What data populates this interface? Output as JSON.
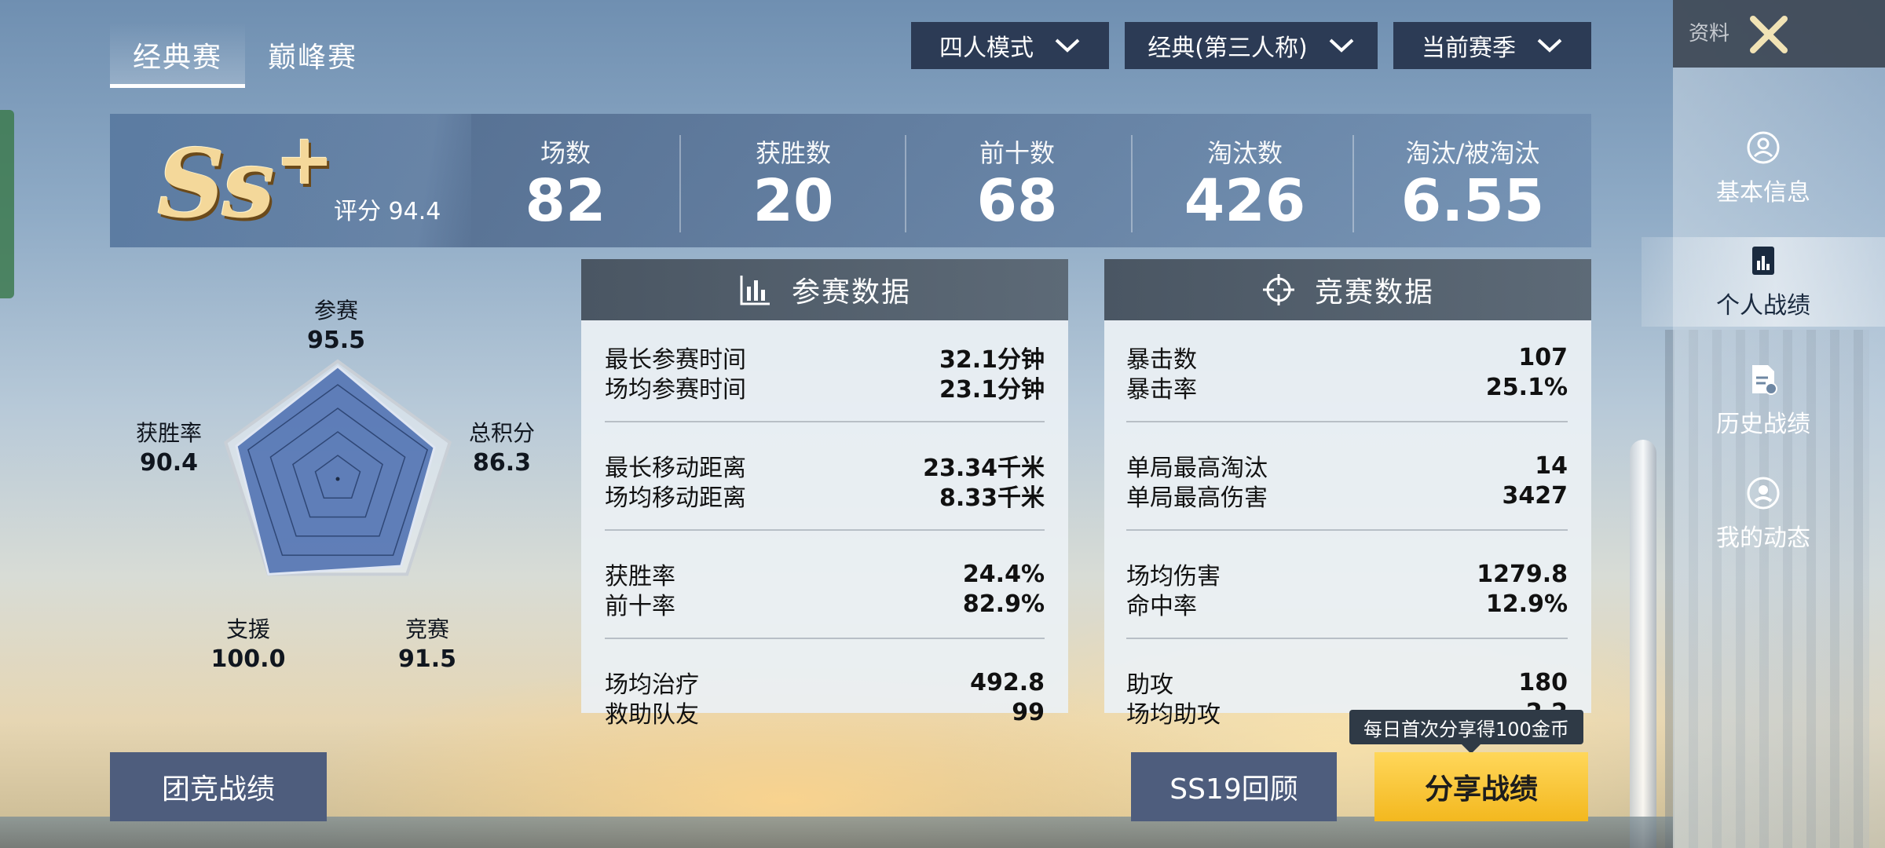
{
  "tabs": [
    {
      "label": "经典赛",
      "active": true
    },
    {
      "label": "巅峰赛",
      "active": false
    }
  ],
  "dropdowns": [
    {
      "value": "四人模式"
    },
    {
      "value": "经典(第三人称)"
    },
    {
      "value": "当前赛季"
    }
  ],
  "side_panel": {
    "top_label": "资料",
    "items": [
      {
        "label": "基本信息",
        "icon": "profile-icon"
      },
      {
        "label": "个人战绩",
        "icon": "stats-doc-icon",
        "active": true
      },
      {
        "label": "历史战绩",
        "icon": "history-doc-icon"
      },
      {
        "label": "我的动态",
        "icon": "activity-icon"
      }
    ]
  },
  "rank": {
    "tier": "Ss",
    "plus": "+",
    "score_label": "评分 94.4"
  },
  "stats": [
    {
      "label": "场数",
      "value": "82"
    },
    {
      "label": "获胜数",
      "value": "20"
    },
    {
      "label": "前十数",
      "value": "68"
    },
    {
      "label": "淘汰数",
      "value": "426"
    },
    {
      "label": "淘汰/被淘汰",
      "value": "6.55"
    }
  ],
  "radar": {
    "axes": [
      {
        "label": "参赛",
        "value": "95.5",
        "score": 95.5
      },
      {
        "label": "总积分",
        "value": "86.3",
        "score": 86.3
      },
      {
        "label": "竞赛",
        "value": "91.5",
        "score": 91.5
      },
      {
        "label": "支援",
        "value": "100.0",
        "score": 100.0
      },
      {
        "label": "获胜率",
        "value": "90.4",
        "score": 90.4
      }
    ]
  },
  "participation": {
    "title": "参赛数据",
    "groups": [
      [
        {
          "label": "最长参赛时间",
          "value": "32.1分钟"
        },
        {
          "label": "场均参赛时间",
          "value": "23.1分钟"
        }
      ],
      [
        {
          "label": "最长移动距离",
          "value": "23.34千米"
        },
        {
          "label": "场均移动距离",
          "value": "8.33千米"
        }
      ],
      [
        {
          "label": "获胜率",
          "value": "24.4%"
        },
        {
          "label": "前十率",
          "value": "82.9%"
        }
      ],
      [
        {
          "label": "场均治疗",
          "value": "492.8"
        },
        {
          "label": "救助队友",
          "value": "99"
        }
      ]
    ]
  },
  "combat": {
    "title": "竞赛数据",
    "groups": [
      [
        {
          "label": "暴击数",
          "value": "107"
        },
        {
          "label": "暴击率",
          "value": "25.1%"
        }
      ],
      [
        {
          "label": "单局最高淘汰",
          "value": "14"
        },
        {
          "label": "单局最高伤害",
          "value": "3427"
        }
      ],
      [
        {
          "label": "场均伤害",
          "value": "1279.8"
        },
        {
          "label": "命中率",
          "value": "12.9%"
        }
      ],
      [
        {
          "label": "助攻",
          "value": "180"
        },
        {
          "label": "场均助攻",
          "value": "2.2"
        }
      ]
    ]
  },
  "buttons": {
    "team": "团竞战绩",
    "review": "SS19回顾",
    "share": "分享战绩",
    "share_tip": "每日首次分享得100金币"
  },
  "colors": {
    "accent_gold": "#f3b81f",
    "panel_head": "#4a5663",
    "radar_fill": "#4d6fb0"
  }
}
